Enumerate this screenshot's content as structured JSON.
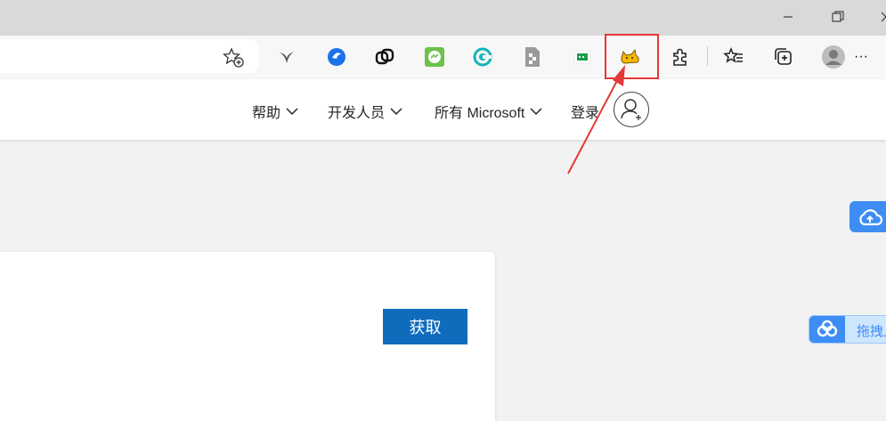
{
  "window": {
    "controls": [
      "minimize-icon",
      "restore-icon",
      "close-icon"
    ]
  },
  "toolbar": {
    "favorite_icon": "add-favorite-icon",
    "extensions": [
      "bird-extension-icon",
      "blue-circle-extension-icon",
      "copy-link-extension-icon",
      "green-chat-extension-icon",
      "teal-c-extension-icon",
      "document-extension-icon",
      "green-screen-extension-icon",
      "yellow-cat-extension-icon"
    ],
    "right_icons": [
      "puzzle-extensions-icon",
      "favorites-icon",
      "collections-icon",
      "profile-icon",
      "more-icon"
    ],
    "more_label": "···"
  },
  "header": {
    "nav": {
      "help": "帮助",
      "developers": "开发人员",
      "all_microsoft": "所有 Microsoft",
      "signin": "登录"
    }
  },
  "card": {
    "get_button": "获取"
  },
  "widgets": {
    "drag_label": "拖拽上"
  },
  "colors": {
    "accent": "#0f6cbd",
    "highlight": "#e53935",
    "cloud_blue": "#3d8df5"
  }
}
